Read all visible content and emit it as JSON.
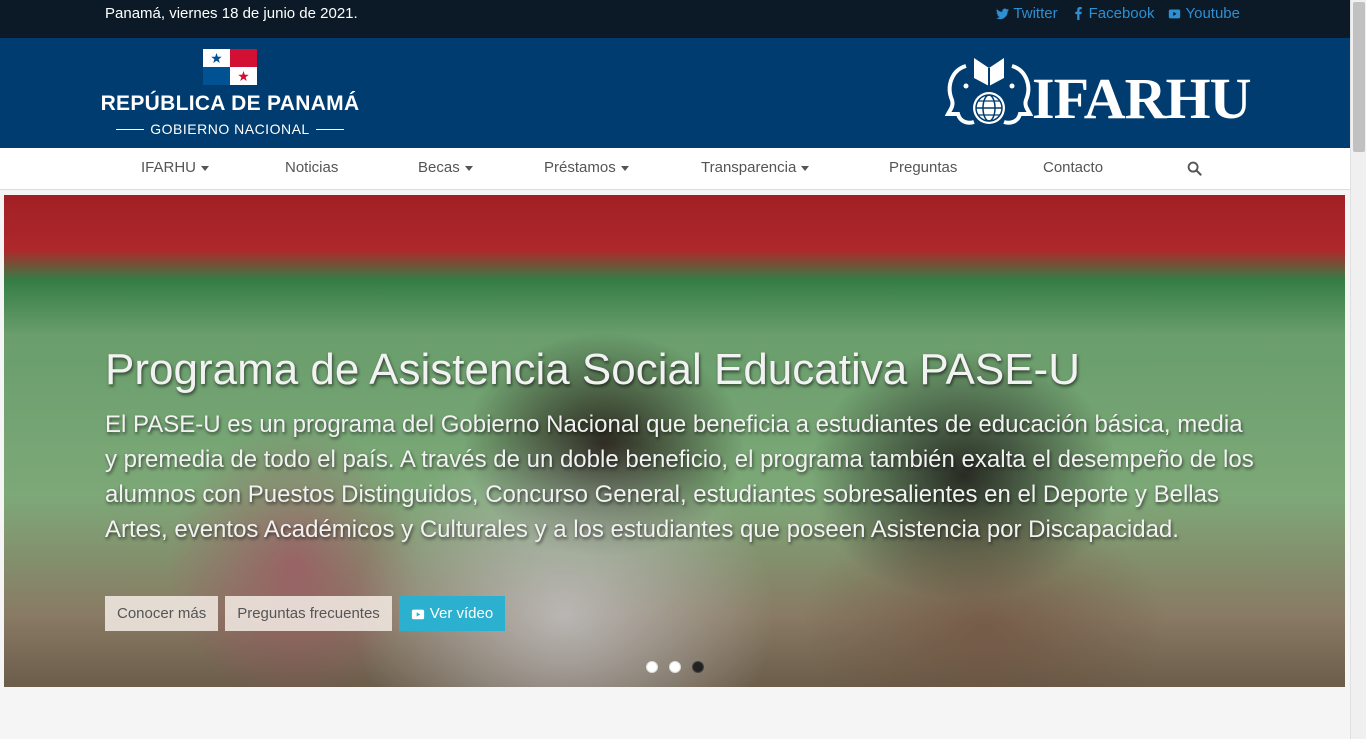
{
  "topbar": {
    "date": "Panamá, viernes 18 de junio de 2021.",
    "social": [
      {
        "label": "Twitter",
        "icon": "twitter-icon"
      },
      {
        "label": "Facebook",
        "icon": "facebook-icon"
      },
      {
        "label": "Youtube",
        "icon": "youtube-icon"
      }
    ]
  },
  "header": {
    "gov_title": "REPÚBLICA DE PANAMÁ",
    "gov_subtitle": "GOBIERNO NACIONAL",
    "brand": "IFARHU"
  },
  "nav": {
    "items": [
      {
        "label": "IFARHU",
        "dropdown": true
      },
      {
        "label": "Noticias",
        "dropdown": false
      },
      {
        "label": "Becas",
        "dropdown": true
      },
      {
        "label": "Préstamos",
        "dropdown": true
      },
      {
        "label": "Transparencia",
        "dropdown": true
      },
      {
        "label": "Preguntas",
        "dropdown": false
      },
      {
        "label": "Contacto",
        "dropdown": false
      }
    ],
    "search_icon": "search-icon"
  },
  "hero": {
    "title": "Programa de Asistencia Social Educativa PASE-U",
    "text": "El PASE-U es un programa del Gobierno Nacional que beneficia a estudiantes de educación básica, media y premedia de todo el país. A través de un doble beneficio, el programa también exalta el desempeño de los alumnos con Puestos Distinguidos, Concurso General, estudiantes sobresalientes en el Deporte y Bellas Artes, eventos Académicos y Culturales y a los estudiantes que poseen Asistencia por Discapacidad.",
    "buttons": {
      "more": "Conocer más",
      "faq": "Preguntas frecuentes",
      "video": "Ver vídeo"
    },
    "slides_total": 3,
    "active_slide": 3
  },
  "colors": {
    "topbar_bg": "#0b1a26",
    "header_bg": "#003c6f",
    "link": "#2e8fd3",
    "video_button": "#2bb0cf"
  }
}
